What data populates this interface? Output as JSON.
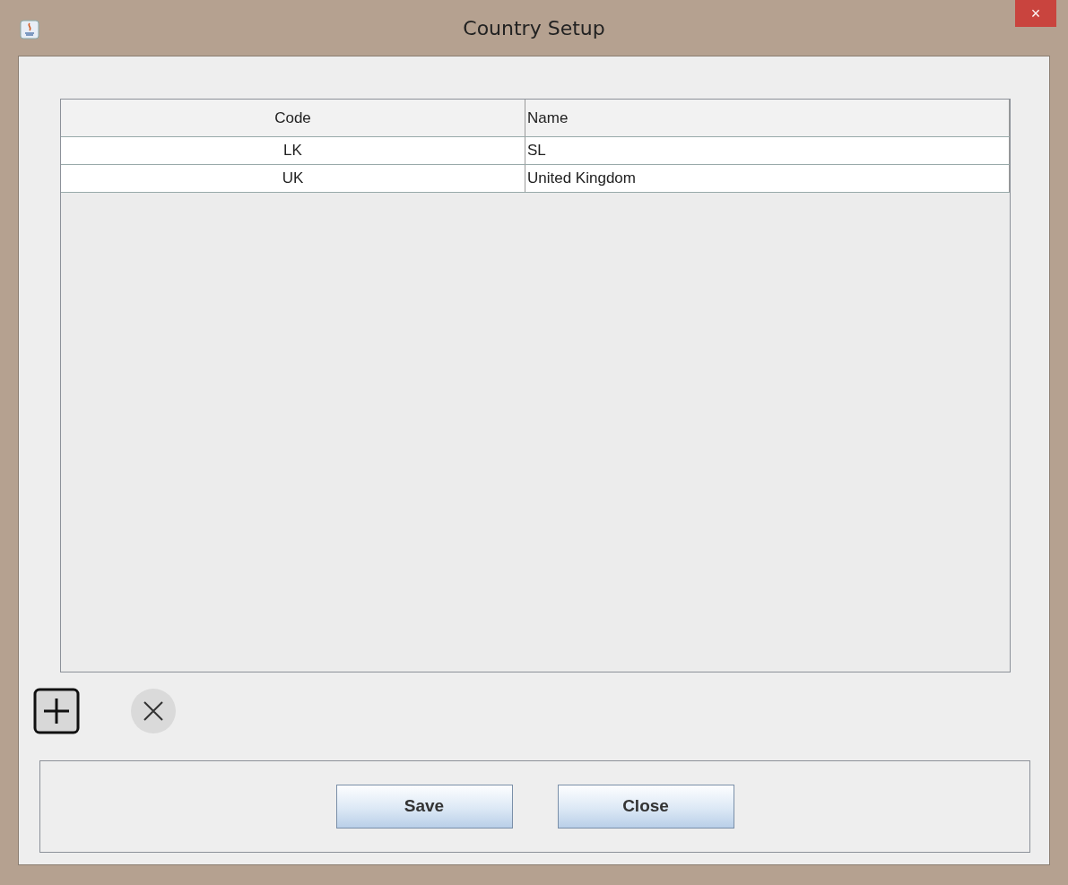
{
  "window": {
    "title": "Country Setup",
    "close_glyph": "×"
  },
  "table": {
    "columns": [
      "Code",
      "Name"
    ],
    "rows": [
      {
        "cells": [
          "LK",
          "SL"
        ]
      },
      {
        "cells": [
          "UK",
          "United Kingdom"
        ]
      }
    ]
  },
  "row_actions": [
    {
      "kind": "add"
    },
    {
      "kind": "remove"
    }
  ],
  "buttons": [
    "Save",
    "Close"
  ]
}
